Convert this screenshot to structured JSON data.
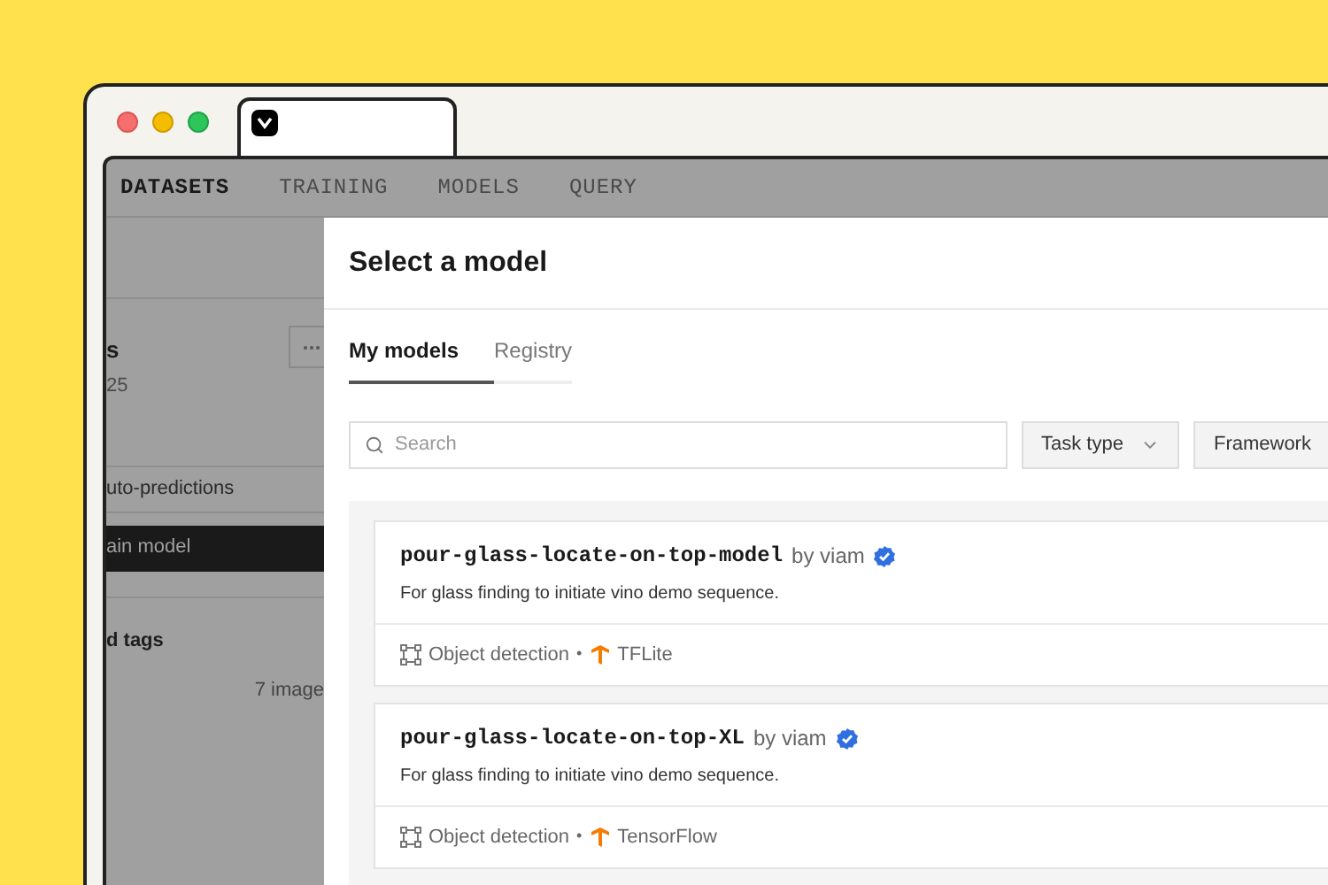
{
  "nav": [
    {
      "label": "DATASETS",
      "selected": true
    },
    {
      "label": "TRAINING",
      "selected": false
    },
    {
      "label": "MODELS",
      "selected": false
    },
    {
      "label": "QUERY",
      "selected": false
    }
  ],
  "sidebar": {
    "title": "s",
    "subtitle": "25",
    "items": [
      {
        "label": "uto-predictions",
        "selected": false
      },
      {
        "label": "ain model",
        "selected": true
      }
    ],
    "section_title": "d tags",
    "count": "7 image"
  },
  "modal": {
    "title": "Select a model",
    "tabs": [
      {
        "label": "My models",
        "selected": true
      },
      {
        "label": "Registry",
        "selected": false
      }
    ],
    "search": {
      "placeholder": "Search"
    },
    "filters": [
      {
        "label": "Task type",
        "dropdown": true
      },
      {
        "label": "Framework",
        "dropdown": false
      }
    ],
    "models": [
      {
        "name": "pour-glass-locate-on-top-model",
        "owner": "by viam",
        "verified": true,
        "description": "For glass finding to initiate vino demo sequence.",
        "task": "Object detection",
        "separator": "•",
        "framework": "TFLite"
      },
      {
        "name": "pour-glass-locate-on-top-XL",
        "owner": "by viam",
        "verified": true,
        "description": "For glass finding to initiate vino demo sequence.",
        "task": "Object detection",
        "separator": "•",
        "framework": "TensorFlow"
      }
    ]
  }
}
